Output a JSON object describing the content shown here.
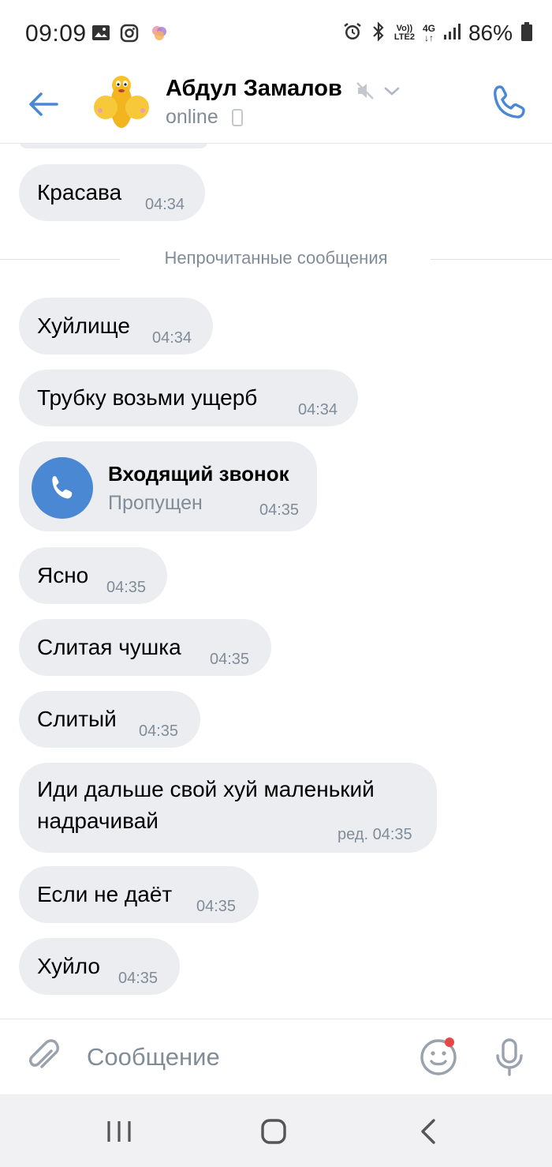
{
  "status_bar": {
    "time": "09:09",
    "battery_percent": "86%",
    "network": {
      "volte_top": "Vo))",
      "volte_bottom": "LTE2",
      "gen": "4G"
    },
    "icons": [
      "gallery-icon",
      "instagram-icon",
      "app-icon",
      "alarm-icon",
      "bluetooth-icon",
      "signal-icon",
      "battery-icon"
    ]
  },
  "header": {
    "contact_name": "Абдул Замалов",
    "status": "online",
    "accent_color": "#4a88d3"
  },
  "messages": [
    {
      "text": "Красава",
      "time": "04:34"
    },
    {
      "text": "Хуйлище",
      "time": "04:34"
    },
    {
      "text": "Трубку возьми ущерб",
      "time": "04:34"
    },
    {
      "text": "Ясно",
      "time": "04:35"
    },
    {
      "text": "Слитая чушка",
      "time": "04:35"
    },
    {
      "text": "Слитый",
      "time": "04:35"
    },
    {
      "line1": "Иди дальше свой хуй маленький",
      "line2": "надрачивай",
      "time": "ред. 04:35"
    },
    {
      "text": "Если не даёт",
      "time": "04:35"
    },
    {
      "text": "Хуйло",
      "time": "04:35"
    }
  ],
  "divider_label": "Непрочитанные сообщения",
  "call_message": {
    "title": "Входящий звонок",
    "subtitle": "Пропущен",
    "time": "04:35"
  },
  "composer": {
    "placeholder": "Сообщение"
  },
  "colors": {
    "bubble": "#ebedf0",
    "secondary_text": "#818c99",
    "notification_dot": "#e64646"
  }
}
